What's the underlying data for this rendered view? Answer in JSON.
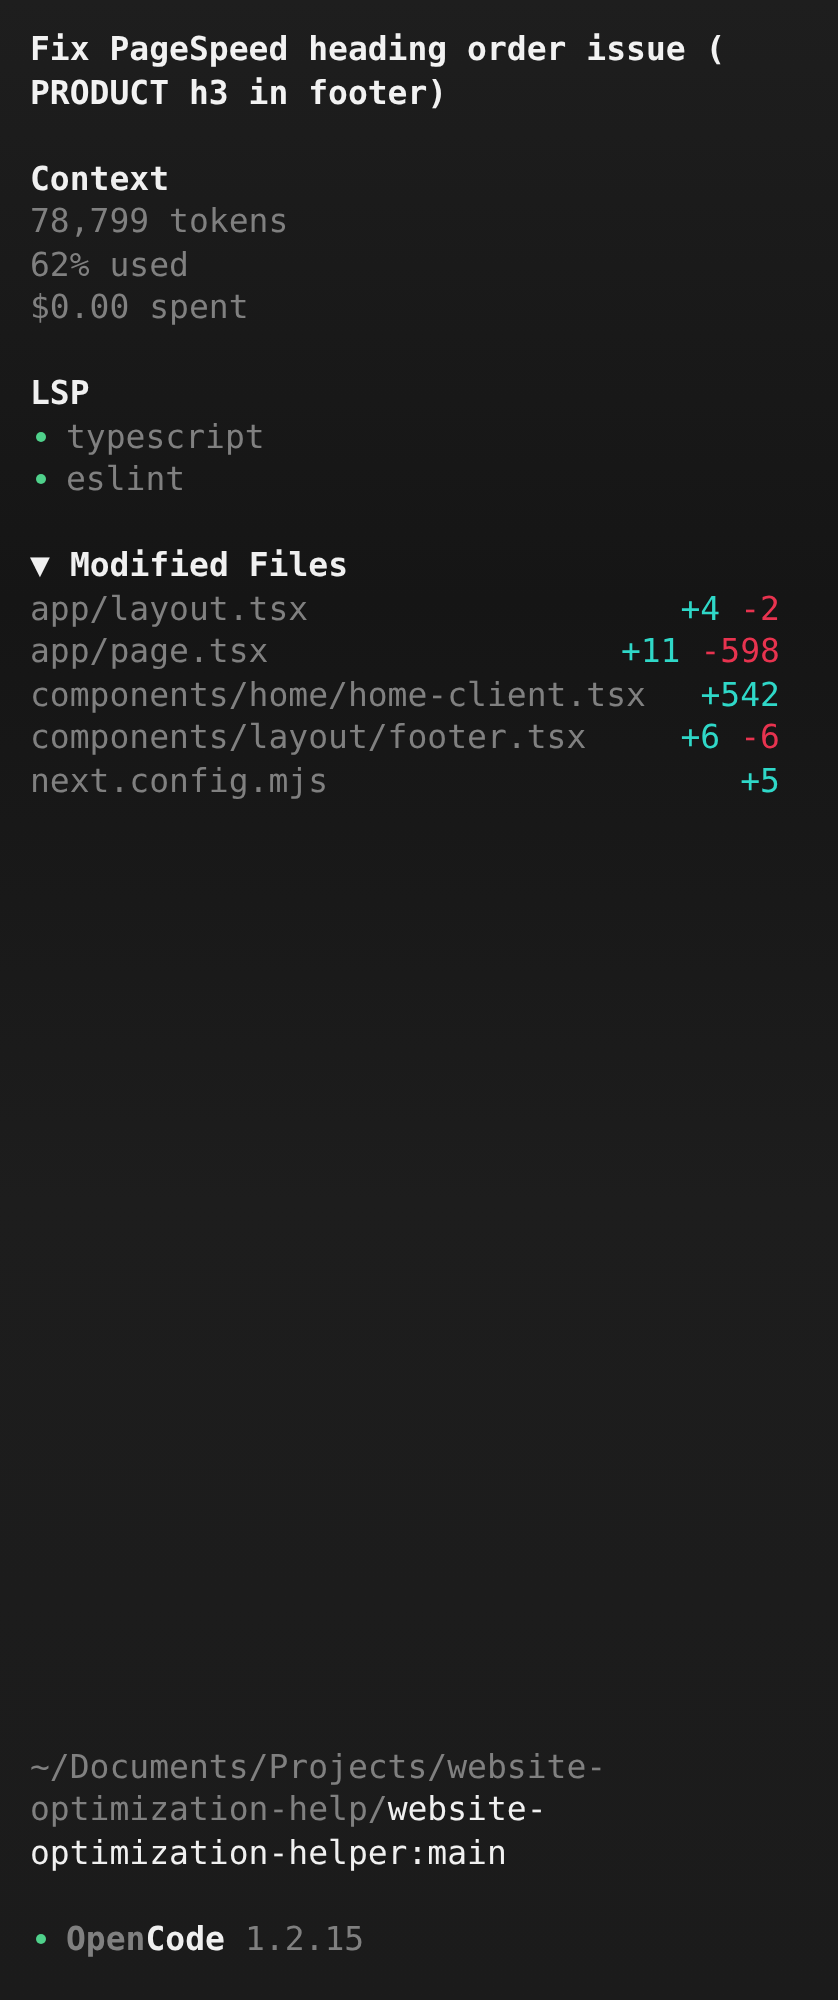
{
  "session_title": "Fix PageSpeed heading order issue ( PRODUCT h3 in footer)",
  "context": {
    "heading": "Context",
    "lines": [
      "78,799 tokens",
      "62% used",
      "$0.00 spent"
    ]
  },
  "lsp": {
    "heading": "LSP",
    "servers": [
      "typescript",
      "eslint"
    ]
  },
  "modified_files": {
    "toggle": "▼",
    "heading": "Modified Files",
    "expanded": true,
    "files": [
      {
        "path": "app/layout.tsx",
        "additions": "+4",
        "deletions": "-2"
      },
      {
        "path": "app/page.tsx",
        "additions": "+11",
        "deletions": "-598"
      },
      {
        "path": "components/home/home-client.tsx",
        "additions": "+542"
      },
      {
        "path": "components/layout/footer.tsx",
        "additions": "+6",
        "deletions": "-6"
      },
      {
        "path": "next.config.mjs",
        "additions": "+5"
      }
    ]
  },
  "directory": {
    "path": "~/Documents/Projects/website-optimization-help/",
    "project": "website-optimization-helper:main"
  },
  "app": {
    "name_dim": "Open",
    "name_bright": "Code",
    "version": "1.2.15"
  }
}
